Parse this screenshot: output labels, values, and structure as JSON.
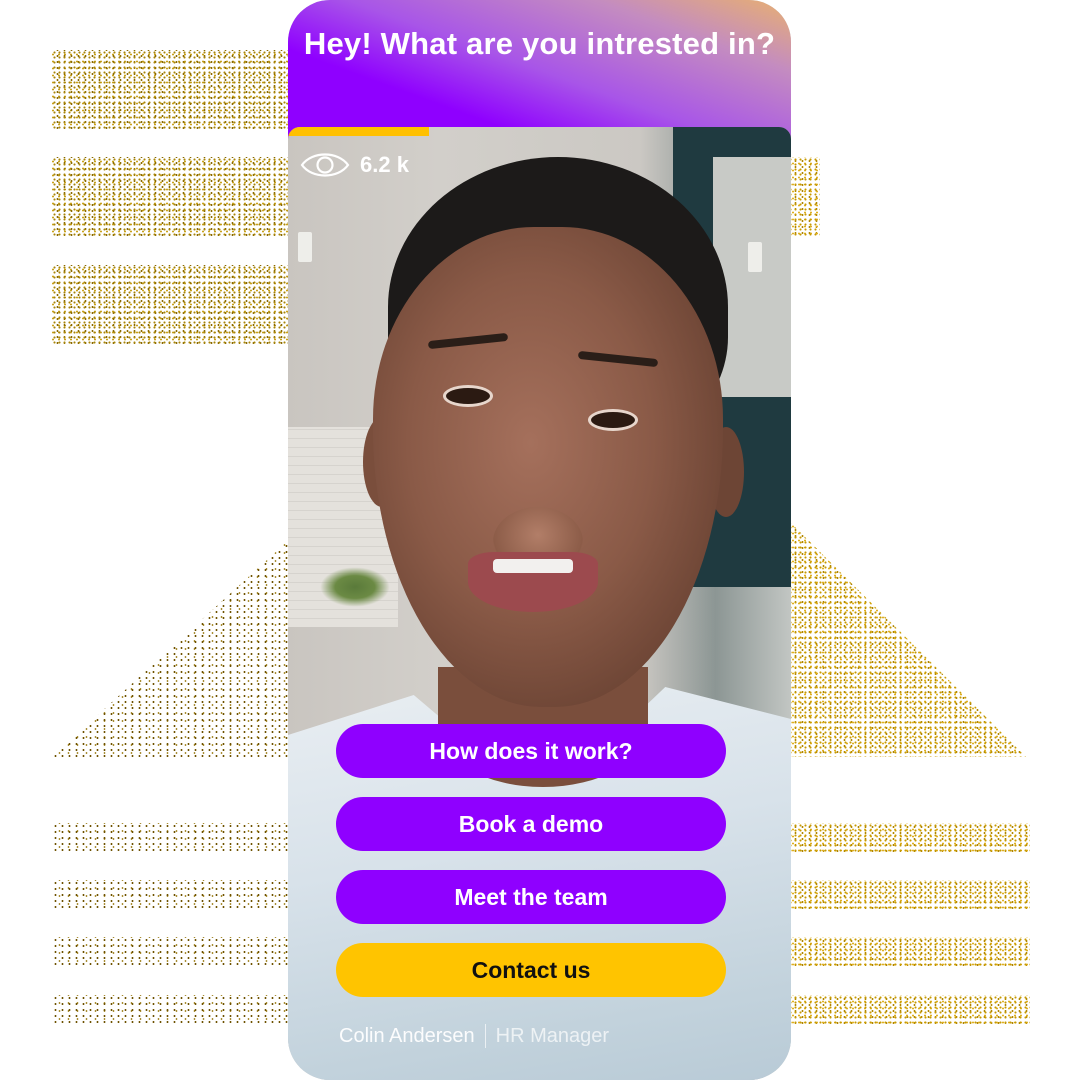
{
  "header": {
    "title": "Hey! What are you intrested in?",
    "gradient": [
      "#8F00FF",
      "#A855E8",
      "#C48CC0",
      "#E8B070"
    ]
  },
  "video": {
    "progress_percent": 28,
    "progress_color": "#FFC000",
    "views": {
      "icon": "eye-icon",
      "count": "6.2 k"
    }
  },
  "actions": [
    {
      "label": "How does it work?",
      "color": "#8F00FF",
      "text_color": "#FFFFFF"
    },
    {
      "label": "Book a demo",
      "color": "#8F00FF",
      "text_color": "#FFFFFF"
    },
    {
      "label": "Meet the team",
      "color": "#8F00FF",
      "text_color": "#FFFFFF"
    },
    {
      "label": "Contact us",
      "color": "#FFC400",
      "text_color": "#111111"
    }
  ],
  "presenter": {
    "name": "Colin Andersen",
    "separator": "|",
    "role": "HR Manager"
  },
  "decoration": {
    "dot_color": "#A8860A"
  }
}
